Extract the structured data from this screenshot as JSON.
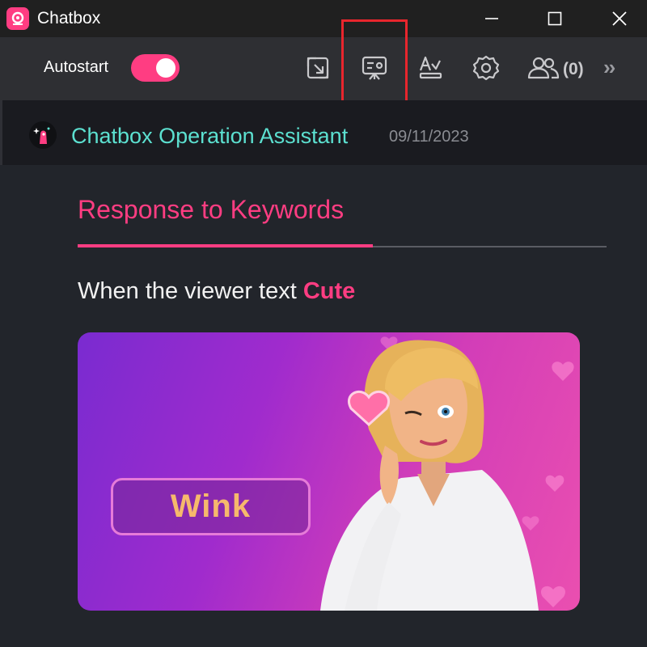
{
  "window": {
    "title": "Chatbox"
  },
  "toolbar": {
    "autostart_label": "Autostart",
    "autostart_on": true,
    "users_count": "(0)",
    "icons": [
      "popout-icon",
      "display-board-icon",
      "text-style-icon",
      "gear-icon",
      "users-icon",
      "chevrons-right-icon"
    ]
  },
  "header": {
    "assistant_name": "Chatbox Operation Assistant",
    "date": "09/11/2023"
  },
  "section": {
    "title": "Response to Keywords",
    "trigger_prefix": "When the viewer text",
    "keyword": "Cute"
  },
  "card": {
    "action_label": "Wink"
  },
  "colors": {
    "accent": "#ff3d82",
    "teal": "#5ce0d0",
    "highlight": "#e8262d"
  }
}
